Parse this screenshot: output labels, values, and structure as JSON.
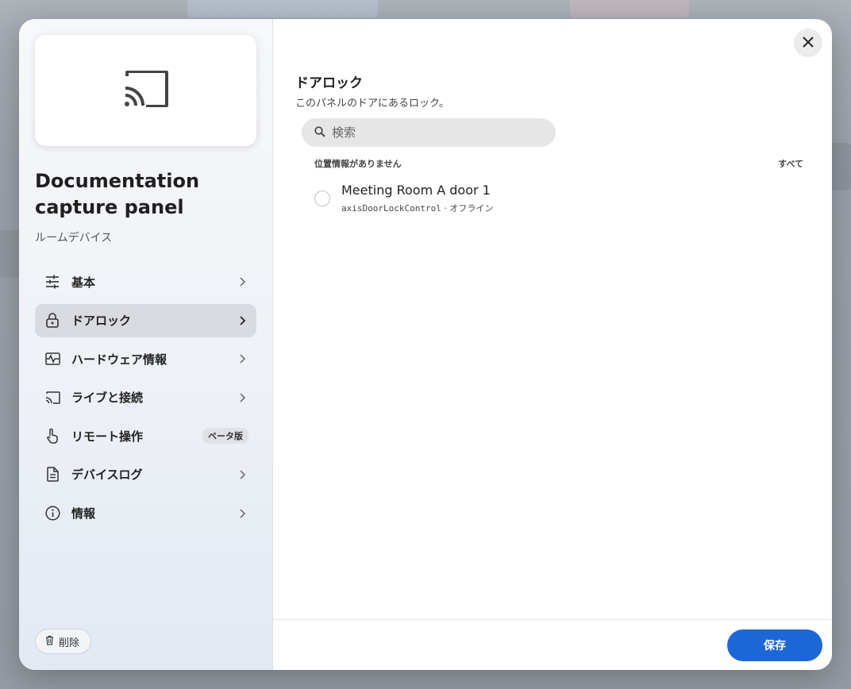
{
  "sidebar": {
    "device_name": "Documentation capture panel",
    "device_type": "ルームデバイス",
    "items": [
      {
        "label": "基本",
        "icon": "sliders-icon"
      },
      {
        "label": "ドアロック",
        "icon": "lock-icon",
        "active": true
      },
      {
        "label": "ハードウェア情報",
        "icon": "monitor-pulse-icon"
      },
      {
        "label": "ライブと接続",
        "icon": "cast-icon"
      },
      {
        "label": "リモート操作",
        "icon": "touch-icon",
        "badge": "ベータ版"
      },
      {
        "label": "デバイスログ",
        "icon": "document-icon"
      },
      {
        "label": "情報",
        "icon": "info-icon"
      }
    ],
    "delete_label": "削除"
  },
  "main": {
    "title": "ドアロック",
    "description": "このパネルのドアにあるロック。",
    "search_placeholder": "検索",
    "group": {
      "header": "位置情報がありません",
      "all_label": "すべて"
    },
    "locks": [
      {
        "name": "Meeting Room A door 1",
        "type": "axisDoorLockControl",
        "separator": "·",
        "status": "オフライン"
      }
    ],
    "save_label": "保存"
  },
  "colors": {
    "accent": "#1b67d8",
    "active_nav": "#d9dbe0"
  }
}
